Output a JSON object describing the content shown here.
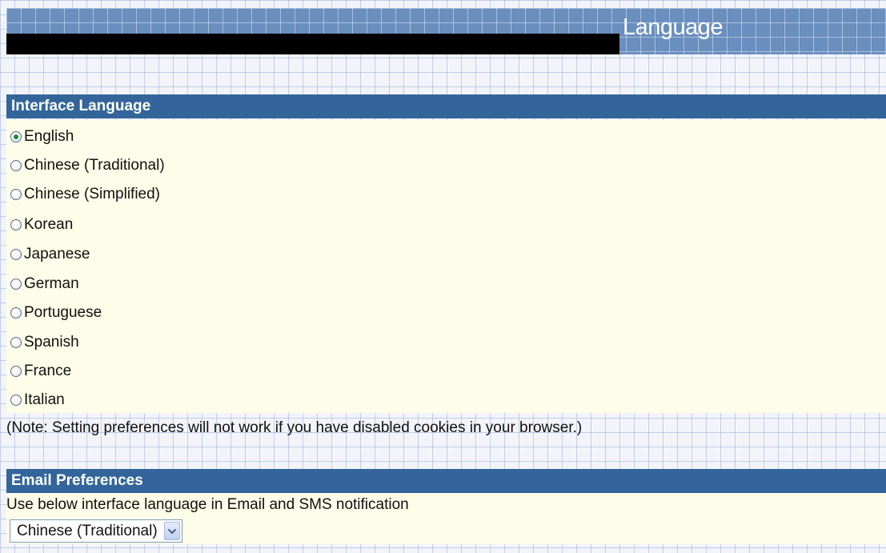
{
  "header": {
    "title": "Language"
  },
  "interface_language": {
    "heading": "Interface Language",
    "selected": "English",
    "options": [
      {
        "label": "English",
        "checked": true
      },
      {
        "label": "Chinese (Traditional)",
        "checked": false
      },
      {
        "label": "Chinese (Simplified)",
        "checked": false
      },
      {
        "label": "Korean",
        "checked": false
      },
      {
        "label": "Japanese",
        "checked": false
      },
      {
        "label": "German",
        "checked": false
      },
      {
        "label": "Portuguese",
        "checked": false
      },
      {
        "label": "Spanish",
        "checked": false
      },
      {
        "label": "France",
        "checked": false
      },
      {
        "label": "Italian",
        "checked": false
      }
    ],
    "note": "(Note: Setting preferences will not work if you have disabled cookies in your browser.)"
  },
  "email_preferences": {
    "heading": "Email Preferences",
    "description": "Use below interface language in Email and SMS notification",
    "select_value": "Chinese (Traditional)"
  },
  "colors": {
    "section_bar": "#33659a",
    "panel_background": "#fdfde9",
    "header_strip": "#6a8fbf",
    "radio_checked_dot": "#1f8a2e"
  },
  "icons": {
    "radio_button": "radio-circle",
    "select_arrow": "chevron-down-icon"
  }
}
